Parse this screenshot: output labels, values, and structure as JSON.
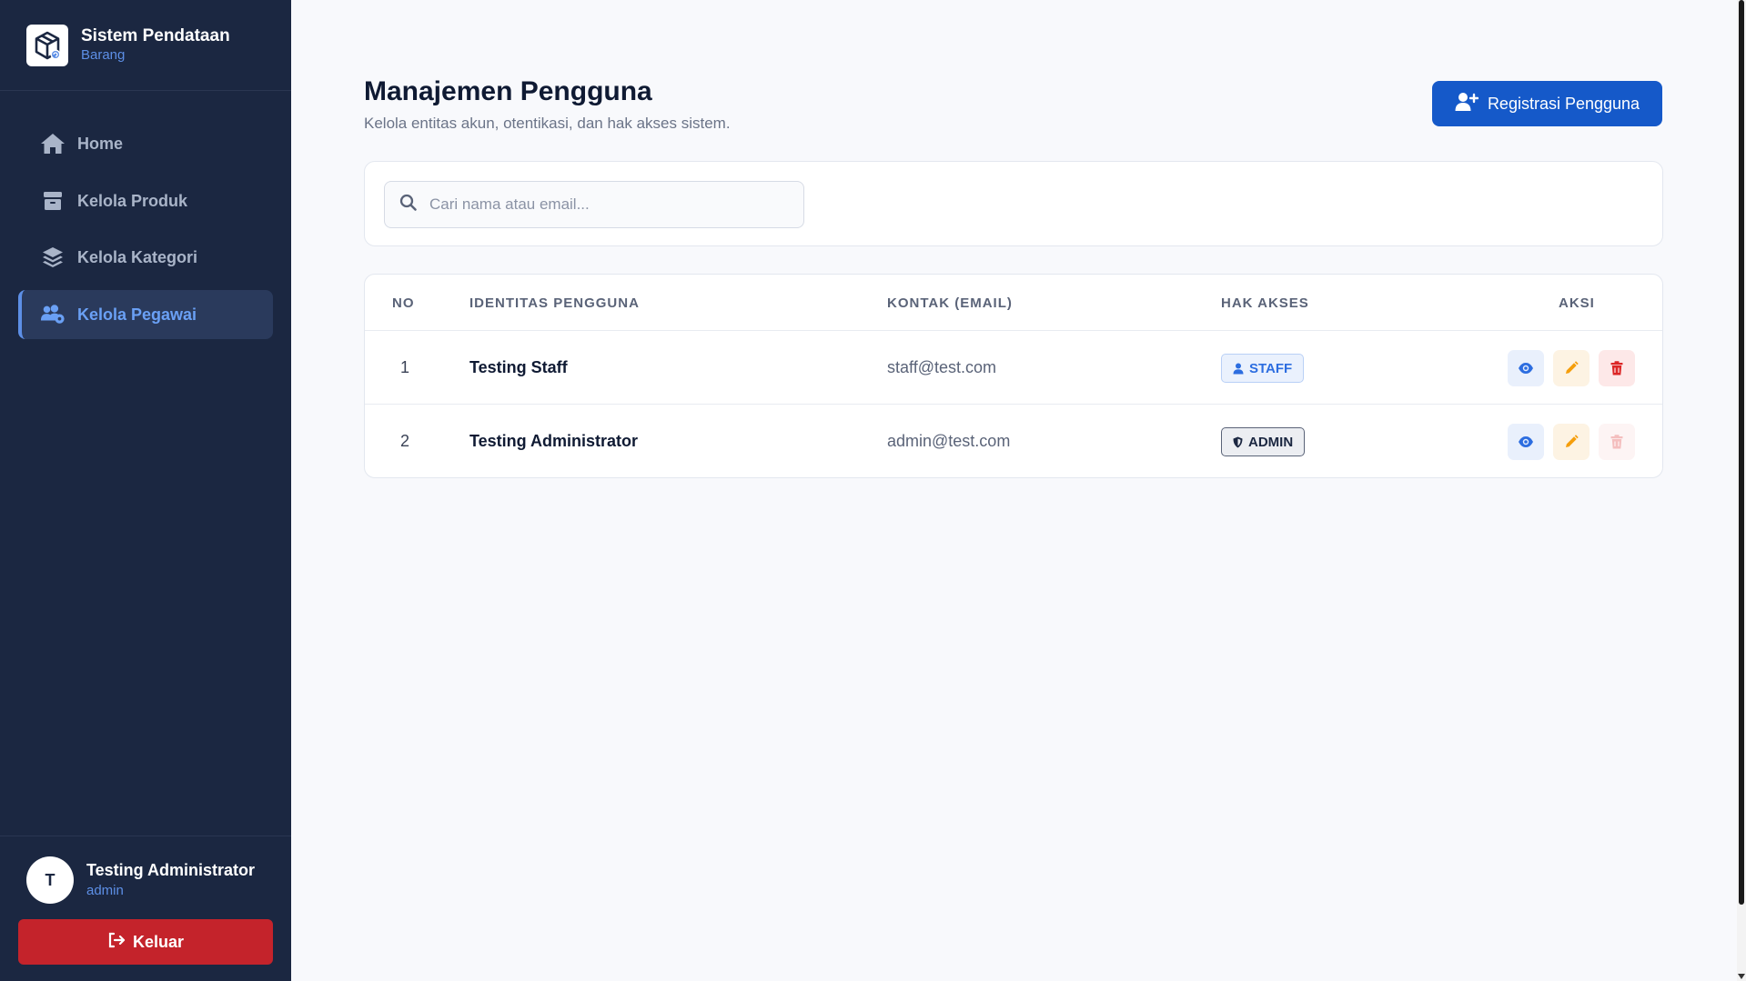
{
  "brand": {
    "title": "Sistem Pendataan",
    "subtitle": "Barang"
  },
  "sidebar": {
    "items": [
      {
        "label": "Home",
        "icon": "home-icon",
        "active": false
      },
      {
        "label": "Kelola Produk",
        "icon": "box-icon",
        "active": false
      },
      {
        "label": "Kelola Kategori",
        "icon": "layers-icon",
        "active": false
      },
      {
        "label": "Kelola Pegawai",
        "icon": "users-gear-icon",
        "active": true
      }
    ]
  },
  "user": {
    "initial": "T",
    "name": "Testing Administrator",
    "role": "admin"
  },
  "logout": {
    "label": "Keluar"
  },
  "header": {
    "title": "Manajemen Pengguna",
    "subtitle": "Kelola entitas akun, otentikasi, dan hak akses sistem.",
    "register_label": "Registrasi Pengguna"
  },
  "search": {
    "placeholder": "Cari nama atau email...",
    "value": ""
  },
  "table": {
    "columns": [
      "NO",
      "IDENTITAS PENGGUNA",
      "KONTAK (EMAIL)",
      "HAK AKSES",
      "AKSI"
    ],
    "rows": [
      {
        "no": "1",
        "name": "Testing Staff",
        "email": "staff@test.com",
        "role": "STAFF",
        "role_icon": "user-icon",
        "delete_enabled": true
      },
      {
        "no": "2",
        "name": "Testing Administrator",
        "email": "admin@test.com",
        "role": "ADMIN",
        "role_icon": "shield-icon",
        "delete_enabled": false
      }
    ]
  },
  "colors": {
    "sidebar_bg": "#1b2741",
    "accent": "#1559c9",
    "active_text": "#6aa0f5",
    "danger": "#c4232b",
    "page_bg": "#f8f9fc"
  }
}
